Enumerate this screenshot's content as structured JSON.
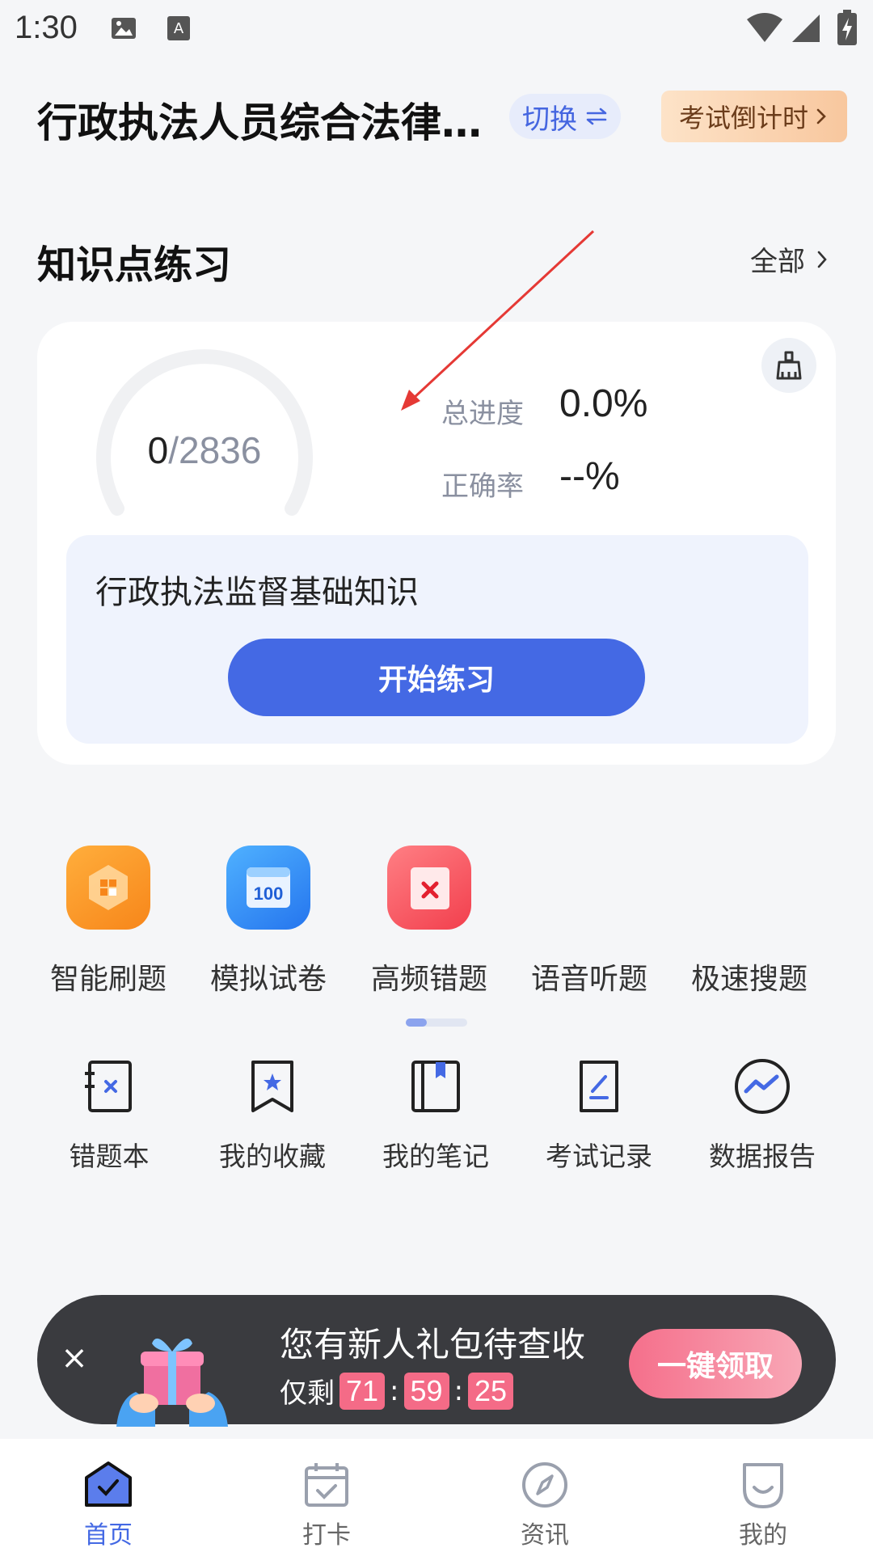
{
  "status_bar": {
    "time": "1:30"
  },
  "header": {
    "exam_title": "行政执法人员综合法律…",
    "switch_label": "切换",
    "countdown_label": "考试倒计时"
  },
  "section": {
    "title": "知识点练习",
    "all_label": "全部"
  },
  "card": {
    "done_count": "0",
    "total_count": "/2836",
    "progress_label": "总进度",
    "progress_value": "0.0%",
    "accuracy_label": "正确率",
    "accuracy_value": "--%",
    "topic": "行政执法监督基础知识",
    "start_label": "开始练习"
  },
  "features": [
    {
      "label": "智能刷题",
      "icon": "smart-practice-icon",
      "color": "#f7931e"
    },
    {
      "label": "模拟试卷",
      "icon": "mock-exam-icon",
      "color": "#2f86f6"
    },
    {
      "label": "高频错题",
      "icon": "frequent-mistakes-icon",
      "color": "#f4505c"
    },
    {
      "label": "语音听题"
    },
    {
      "label": "极速搜题"
    }
  ],
  "tools": [
    {
      "label": "错题本",
      "icon": "mistake-book-icon"
    },
    {
      "label": "我的收藏",
      "icon": "bookmark-icon"
    },
    {
      "label": "我的笔记",
      "icon": "notes-icon"
    },
    {
      "label": "考试记录",
      "icon": "exam-record-icon"
    },
    {
      "label": "数据报告",
      "icon": "data-report-icon"
    }
  ],
  "promo": {
    "title": "您有新人礼包待查收",
    "remaining_label": "仅剩",
    "hours": "71",
    "minutes": "59",
    "seconds": "25",
    "claim_label": "一键领取"
  },
  "nav": [
    {
      "label": "首页",
      "active": true
    },
    {
      "label": "打卡"
    },
    {
      "label": "资讯"
    },
    {
      "label": "我的"
    }
  ],
  "colors": {
    "accent": "#4469e4",
    "promo": "#f46b87",
    "annotation_arrow": "#e53935"
  }
}
